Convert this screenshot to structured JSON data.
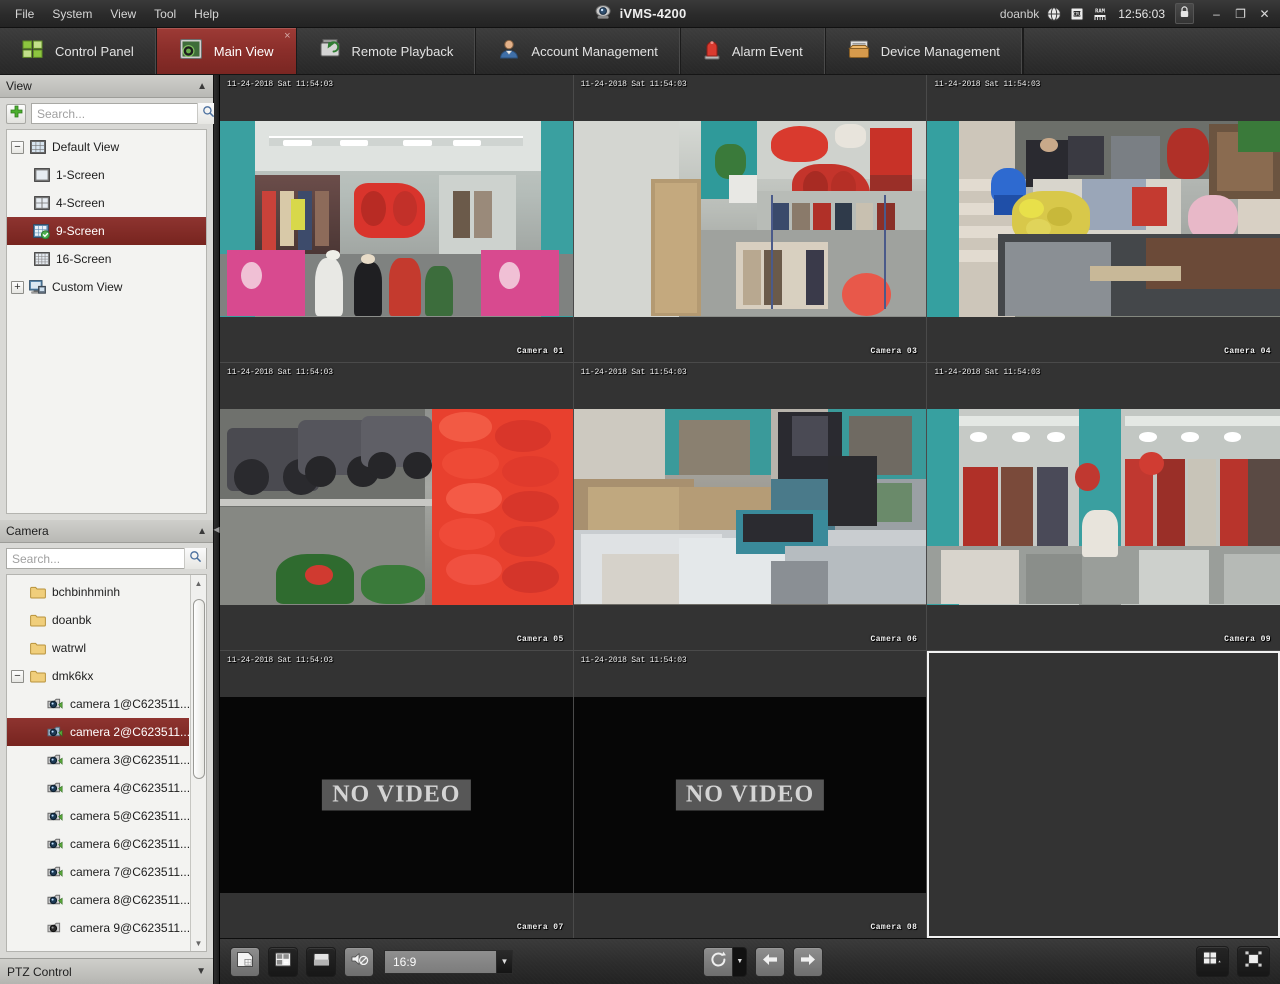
{
  "window": {
    "app_title": "iVMS-4200",
    "user": "doanbk",
    "clock": "12:56:03",
    "minimize_label": "–",
    "restore_label": "❐",
    "close_label": "✕",
    "status_icons": [
      "network-icon",
      "cpu-icon",
      "ram-icon"
    ],
    "lock_icon": "lock-icon"
  },
  "menubar": {
    "items": [
      {
        "label": "File"
      },
      {
        "label": "System"
      },
      {
        "label": "View"
      },
      {
        "label": "Tool"
      },
      {
        "label": "Help"
      }
    ]
  },
  "tabs": [
    {
      "label": "Control Panel",
      "icon": "control-panel-icon",
      "active": false
    },
    {
      "label": "Main View",
      "icon": "main-view-icon",
      "active": true,
      "close": "×"
    },
    {
      "label": "Remote Playback",
      "icon": "remote-playback-icon",
      "active": false
    },
    {
      "label": "Account Management",
      "icon": "account-management-icon",
      "active": false
    },
    {
      "label": "Alarm Event",
      "icon": "alarm-event-icon",
      "active": false
    },
    {
      "label": "Device Management",
      "icon": "device-management-icon",
      "active": false
    }
  ],
  "view_panel": {
    "title": "View",
    "collapse_icon": "chevron-up-icon",
    "add_icon": "plus-icon",
    "search_placeholder": "Search...",
    "search_value": "",
    "search_icon": "search-icon",
    "tree": [
      {
        "label": "Default View",
        "icon": "default-view-icon",
        "expander": "−",
        "depth": 0,
        "selected": false
      },
      {
        "label": "1-Screen",
        "icon": "screen-1-icon",
        "expander": "",
        "depth": 1,
        "selected": false
      },
      {
        "label": "4-Screen",
        "icon": "screen-4-icon",
        "expander": "",
        "depth": 1,
        "selected": false
      },
      {
        "label": "9-Screen",
        "icon": "screen-9-icon",
        "expander": "",
        "depth": 1,
        "selected": true
      },
      {
        "label": "16-Screen",
        "icon": "screen-16-icon",
        "expander": "",
        "depth": 1,
        "selected": false
      },
      {
        "label": "Custom View",
        "icon": "custom-view-icon",
        "expander": "+",
        "depth": 0,
        "selected": false
      }
    ]
  },
  "camera_panel": {
    "title": "Camera",
    "collapse_icon": "chevron-up-icon",
    "search_placeholder": "Search...",
    "search_value": "",
    "search_icon": "search-icon",
    "tree": [
      {
        "label": "bchbinhminh",
        "icon": "folder-icon",
        "expander": "",
        "depth": 0,
        "selected": false
      },
      {
        "label": "doanbk",
        "icon": "folder-icon",
        "expander": "",
        "depth": 0,
        "selected": false
      },
      {
        "label": "watrwl",
        "icon": "folder-icon",
        "expander": "",
        "depth": 0,
        "selected": false
      },
      {
        "label": "dmk6kx",
        "icon": "folder-icon",
        "expander": "−",
        "depth": 0,
        "selected": false
      },
      {
        "label": "camera 1@C623511...",
        "icon": "camera-icon",
        "expander": "",
        "depth": 1,
        "selected": false
      },
      {
        "label": "camera 2@C623511...",
        "icon": "camera-icon",
        "expander": "",
        "depth": 1,
        "selected": true
      },
      {
        "label": "camera 3@C623511...",
        "icon": "camera-icon",
        "expander": "",
        "depth": 1,
        "selected": false
      },
      {
        "label": "camera 4@C623511...",
        "icon": "camera-icon",
        "expander": "",
        "depth": 1,
        "selected": false
      },
      {
        "label": "camera 5@C623511...",
        "icon": "camera-icon",
        "expander": "",
        "depth": 1,
        "selected": false
      },
      {
        "label": "camera 6@C623511...",
        "icon": "camera-icon",
        "expander": "",
        "depth": 1,
        "selected": false
      },
      {
        "label": "camera 7@C623511...",
        "icon": "camera-icon",
        "expander": "",
        "depth": 1,
        "selected": false
      },
      {
        "label": "camera 8@C623511...",
        "icon": "camera-icon",
        "expander": "",
        "depth": 1,
        "selected": false
      },
      {
        "label": "camera 9@C623511...",
        "icon": "camera-icon",
        "expander": "",
        "depth": 1,
        "selected": false
      }
    ]
  },
  "ptz_panel": {
    "title": "PTZ Control",
    "expand_icon": "chevron-down-icon"
  },
  "video_grid": {
    "layout": "9-screen",
    "cells": [
      {
        "index": 1,
        "timestamp": "11-24-2018 Sat 11:54:03",
        "camera_label": "Camera 01",
        "state": "live",
        "scene": "shop-wide",
        "selected": false
      },
      {
        "index": 2,
        "timestamp": "11-24-2018 Sat 11:54:03",
        "camera_label": "Camera 03",
        "state": "live",
        "scene": "shop-aisle",
        "selected": false
      },
      {
        "index": 3,
        "timestamp": "11-24-2018 Sat 11:54:03",
        "camera_label": "Camera 04",
        "state": "live",
        "scene": "shop-stairs",
        "selected": false
      },
      {
        "index": 4,
        "timestamp": "11-24-2018 Sat 11:54:03",
        "camera_label": "Camera 05",
        "state": "live",
        "scene": "street-bikes",
        "selected": false
      },
      {
        "index": 5,
        "timestamp": "11-24-2018 Sat 11:54:03",
        "camera_label": "Camera 06",
        "state": "live",
        "scene": "storage-room",
        "selected": false
      },
      {
        "index": 6,
        "timestamp": "11-24-2018 Sat 11:54:03",
        "camera_label": "Camera 09",
        "state": "live",
        "scene": "shop-racks",
        "selected": false
      },
      {
        "index": 7,
        "timestamp": "11-24-2018 Sat 11:54:03",
        "camera_label": "Camera 07",
        "state": "no-video",
        "no_video_text": "NO VIDEO",
        "selected": false
      },
      {
        "index": 8,
        "timestamp": "11-24-2018 Sat 11:54:03",
        "camera_label": "Camera 08",
        "state": "no-video",
        "no_video_text": "NO VIDEO",
        "selected": false
      },
      {
        "index": 9,
        "timestamp": "",
        "camera_label": "",
        "state": "empty",
        "selected": true
      }
    ]
  },
  "toolbar": {
    "capture_icon": "capture-picture-icon",
    "multi_capture_icon": "multi-capture-icon",
    "stop_all_icon": "stop-all-icon",
    "audio_icon": "audio-mute-icon",
    "aspect_value": "16:9",
    "aspect_arrow": "chevron-down-icon",
    "autoswitch_icon": "auto-switch-icon",
    "autoswitch_arrow": "chevron-down-icon",
    "previous_icon": "arrow-left-icon",
    "next_icon": "arrow-right-icon",
    "layout_icon": "window-division-icon",
    "layout_arrow": "chevron-up-icon",
    "fullscreen_icon": "full-screen-icon"
  }
}
